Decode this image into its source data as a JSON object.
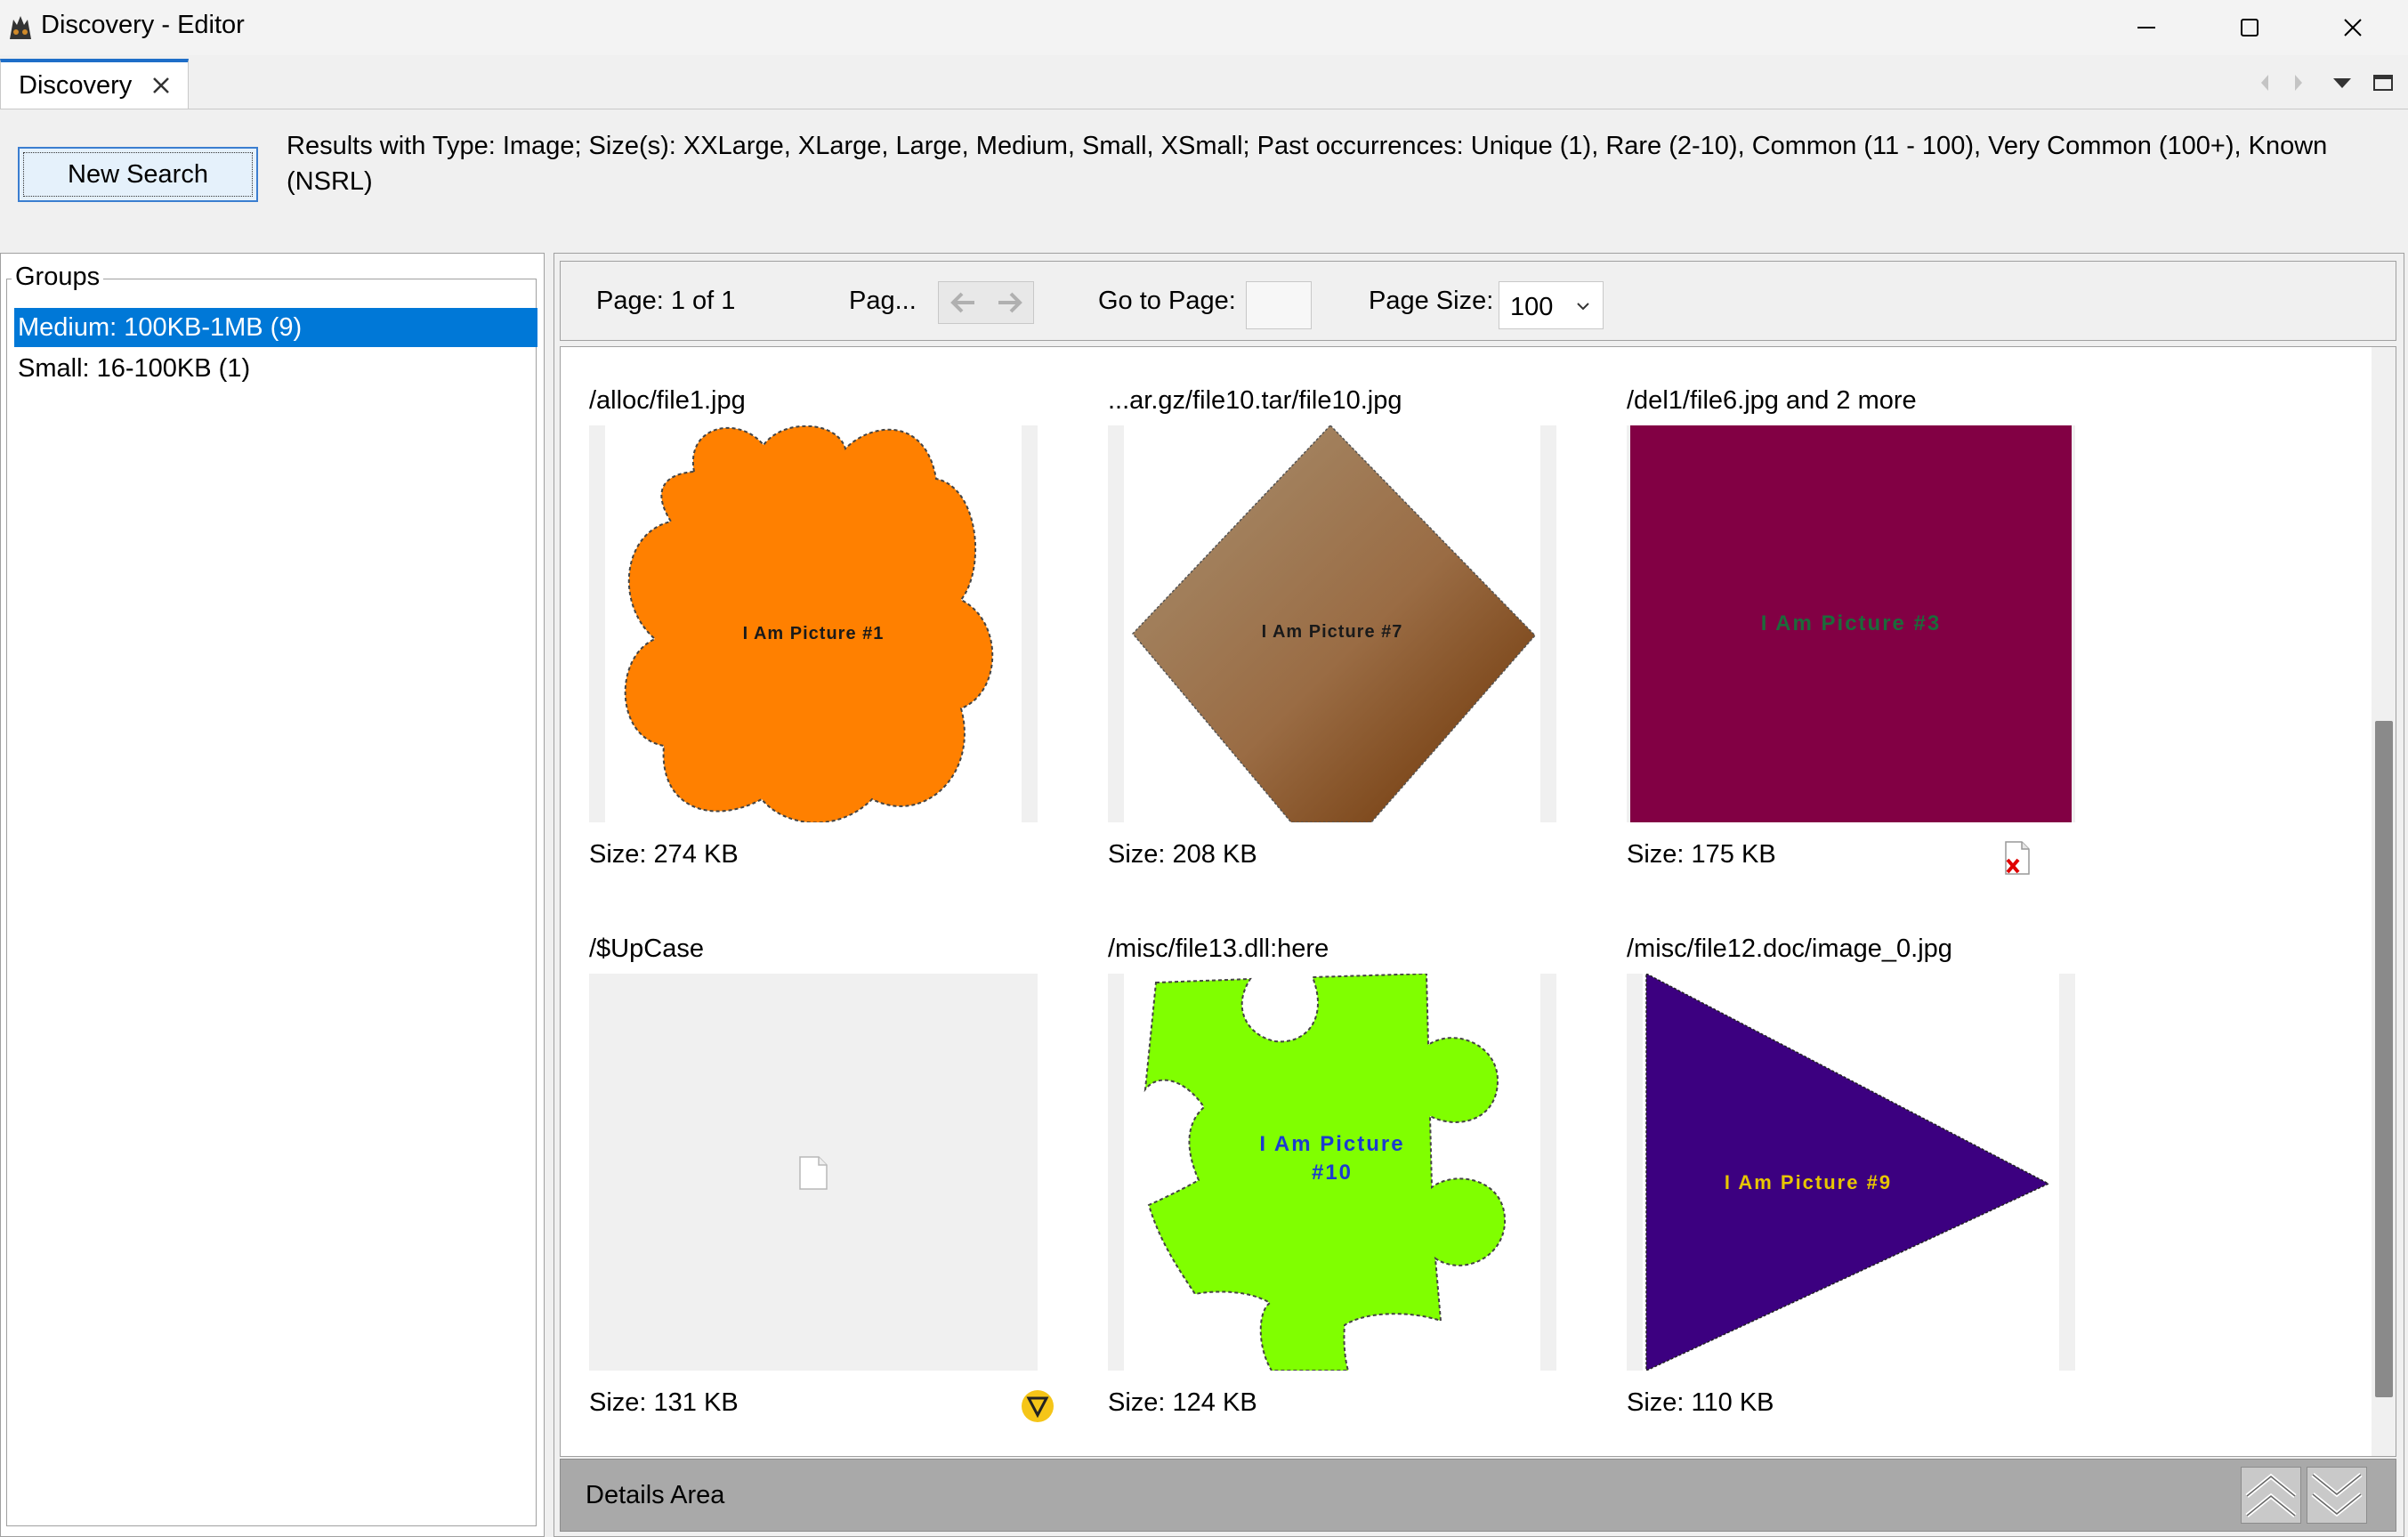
{
  "window": {
    "title": "Discovery - Editor",
    "controls": [
      "minimize",
      "maximize",
      "close"
    ]
  },
  "tab": {
    "label": "Discovery"
  },
  "search": {
    "new_search_label": "New Search",
    "criteria_text": "Results with Type: Image; Size(s): XXLarge, XLarge, Large, Medium, Small, XSmall; Past occurrences: Unique (1), Rare (2-10), Common (11 - 100), Very Common (100+), Known (NSRL)"
  },
  "groups": {
    "title": "Groups",
    "items": [
      {
        "label": "Medium: 100KB-1MB (9)",
        "selected": true
      },
      {
        "label": "Small: 16-100KB (1)",
        "selected": false
      }
    ]
  },
  "pager": {
    "page_label": "Page: 1 of 1",
    "page_truncated_label": "Pag...",
    "goto_label": "Go to Page:",
    "goto_value": "",
    "page_size_label": "Page Size:",
    "page_size_value": "100"
  },
  "results": [
    {
      "path": "/alloc/file1.jpg",
      "size": "Size: 274 KB",
      "image_text": "I Am Picture #1",
      "shape": "flower",
      "color": "#ff8000",
      "status_icon": null
    },
    {
      "path": "...ar.gz/file10.tar/file10.jpg",
      "size": "Size: 208 KB",
      "image_text": "I Am Picture #7",
      "shape": "diamond",
      "color": "#9c7048",
      "status_icon": null
    },
    {
      "path": "/del1/file6.jpg and 2 more",
      "size": "Size: 175 KB",
      "image_text": "I Am Picture #3",
      "shape": "square",
      "color": "#820044",
      "status_icon": "deleted-file-icon"
    },
    {
      "path": "/$UpCase",
      "size": "Size: 131 KB",
      "image_text": "",
      "shape": "blank-file",
      "color": "#f0f0f0",
      "status_icon": "warning-icon"
    },
    {
      "path": "/misc/file13.dll:here",
      "size": "Size: 124 KB",
      "image_text": "I Am Picture #10",
      "shape": "puzzle",
      "color": "#80ff00",
      "status_icon": null
    },
    {
      "path": "/misc/file12.doc/image_0.jpg",
      "size": "Size: 110 KB",
      "image_text": "I Am Picture #9",
      "shape": "triangle",
      "color": "#3c0080",
      "status_icon": null
    }
  ],
  "details": {
    "label": "Details Area"
  },
  "colors": {
    "accent": "#0078d7",
    "warning": "#f5c518",
    "deleted": "#e00000"
  }
}
